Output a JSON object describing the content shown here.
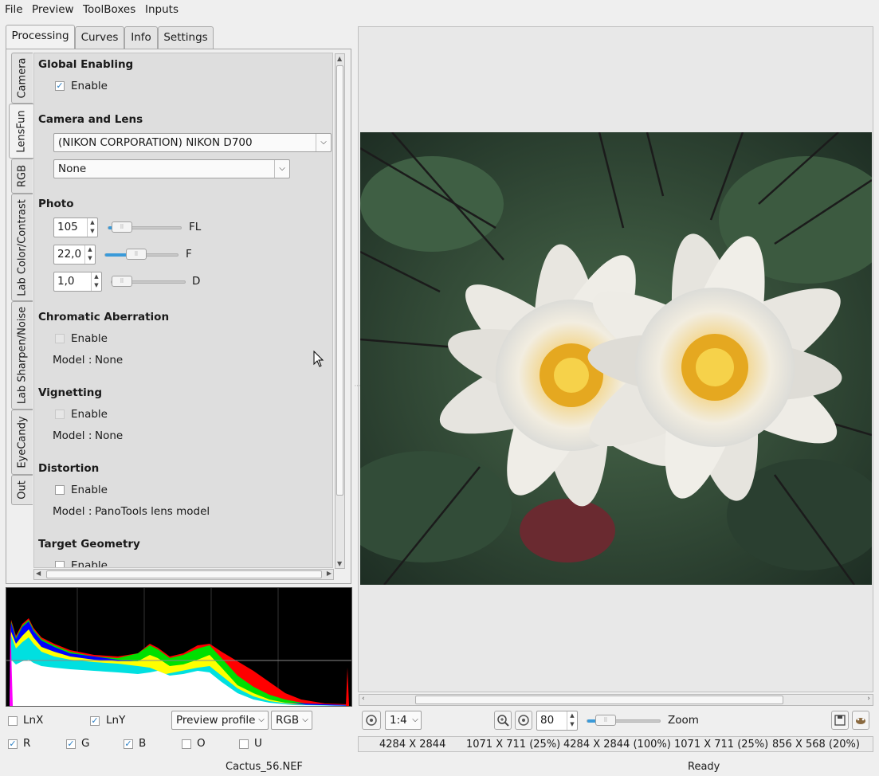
{
  "menu": [
    "File",
    "Preview",
    "ToolBoxes",
    "Inputs"
  ],
  "top_tabs": [
    "Processing",
    "Curves",
    "Info",
    "Settings"
  ],
  "side_tabs": [
    "Camera",
    "LensFun",
    "RGB",
    "Lab Color/Contrast",
    "Lab Sharpen/Noise",
    "EyeCandy",
    "Out"
  ],
  "sections": {
    "global": {
      "title": "Global Enabling",
      "enable_label": "Enable",
      "checked": true
    },
    "camera": {
      "title": "Camera and Lens",
      "camera_value": "(NIKON CORPORATION) NIKON D700",
      "lens_value": "None"
    },
    "photo": {
      "title": "Photo",
      "fields": [
        {
          "value": "105",
          "label": "FL",
          "level": 0.05
        },
        {
          "value": "22,0",
          "label": "F",
          "level": 0.33
        },
        {
          "value": "1,0",
          "label": "D",
          "level": 0.0
        }
      ]
    },
    "chromatic": {
      "title": "Chromatic Aberration",
      "enable_label": "Enable",
      "model_label": "Model :",
      "model_value": "None"
    },
    "vignetting": {
      "title": "Vignetting",
      "enable_label": "Enable",
      "model_label": "Model :",
      "model_value": "None"
    },
    "distortion": {
      "title": "Distortion",
      "enable_label": "Enable",
      "model_label": "Model :",
      "model_value": "PanoTools lens model"
    },
    "target": {
      "title": "Target Geometry",
      "enable_label": "Enable"
    }
  },
  "histogram_options": {
    "lnx": {
      "label": "LnX",
      "checked": false
    },
    "lny": {
      "label": "LnY",
      "checked": true
    },
    "profile": "Preview profile",
    "mode": "RGB",
    "channels": [
      {
        "label": "R",
        "checked": true
      },
      {
        "label": "G",
        "checked": true
      },
      {
        "label": "B",
        "checked": true
      },
      {
        "label": "O",
        "checked": false
      },
      {
        "label": "U",
        "checked": false
      }
    ]
  },
  "preview_controls": {
    "scale": "1:4",
    "zoom_value": "80",
    "zoom_label": "Zoom"
  },
  "status": [
    "4284 X 2844",
    "1071 X 711 (25%)",
    "4284 X 2844 (100%)",
    "1071 X 711 (25%)",
    "856 X 568 (20%)"
  ],
  "bottom": {
    "filename": "Cactus_56.NEF",
    "state": "Ready"
  },
  "colors": {
    "accent": "#3a9ad9",
    "panel": "#efefef"
  }
}
